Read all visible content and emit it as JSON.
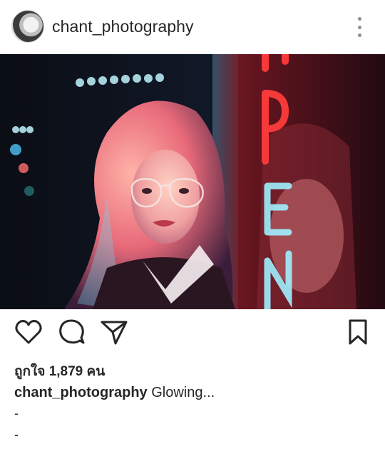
{
  "post": {
    "username": "chant_photography",
    "likes_text": "ถูกใจ 1,879 คน",
    "caption_user": "chant_photography",
    "caption_text": "Glowing...",
    "extra_lines": [
      "-",
      "-"
    ]
  },
  "icons": {
    "more": "more-vertical-icon",
    "like": "heart-icon",
    "comment": "comment-icon",
    "share": "paper-plane-icon",
    "save": "bookmark-icon"
  },
  "colors": {
    "text": "#262626",
    "muted": "#8e8e8e",
    "neon_red": "#ff3b3b",
    "neon_cyan": "#7fe8ff"
  }
}
